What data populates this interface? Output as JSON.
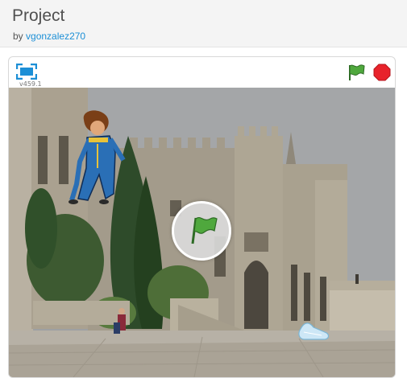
{
  "page": {
    "title": "Project",
    "by_prefix": "by",
    "author": "vgonzalez270"
  },
  "player": {
    "version": "v459.1",
    "icons": {
      "fullscreen": "fullscreen-icon",
      "green_flag": "green-flag-icon",
      "stop": "stop-sign-icon",
      "start_overlay": "start-flag-icon"
    },
    "colors": {
      "flag_green": "#4fa83d",
      "stop_red": "#e8232b",
      "fullscreen_blue": "#1c8fd6",
      "link_blue": "#1c8fd6"
    }
  },
  "stage": {
    "scene": "stone palace courtyard",
    "sprites": [
      "prince",
      "glass-slipper"
    ]
  }
}
